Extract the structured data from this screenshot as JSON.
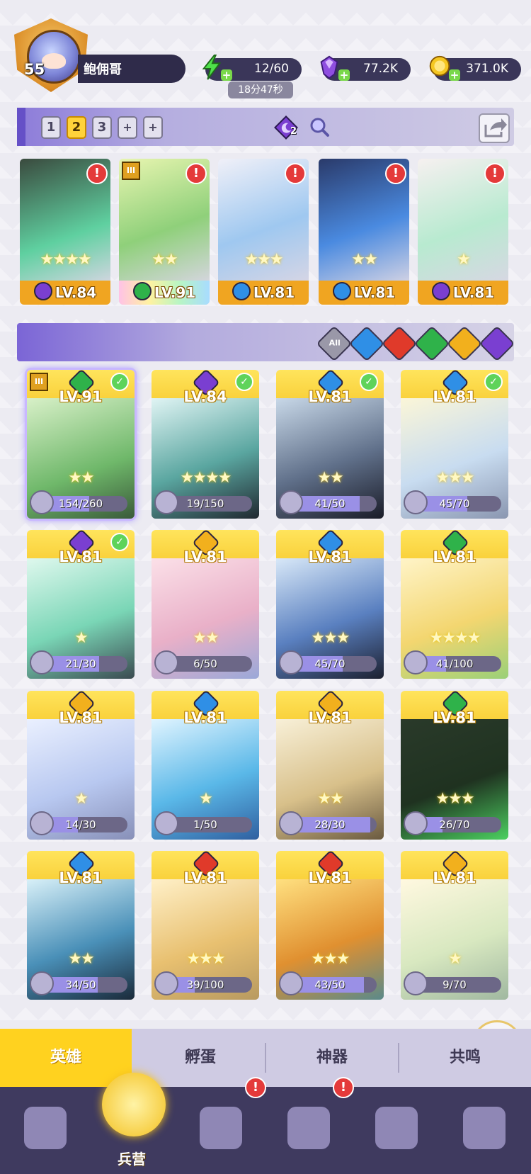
{
  "player": {
    "level": "55",
    "name": "鲍佣哥"
  },
  "resources": {
    "energy": {
      "value": "12/60",
      "timer": "18分47秒",
      "icon": "lightning-icon"
    },
    "gems": {
      "value": "77.2K",
      "icon": "gem-icon"
    },
    "coins": {
      "value": "371.0K",
      "icon": "coin-icon"
    }
  },
  "team_tabs": [
    "1",
    "2",
    "3",
    "+",
    "+"
  ],
  "team_active": "2",
  "team_badge": "2",
  "team": [
    {
      "level": "LV.84",
      "element": "dark",
      "stars": "★★★★",
      "alert": "!"
    },
    {
      "level": "LV.91",
      "element": "nature",
      "stars": "★★",
      "alert": "!",
      "rank": "III"
    },
    {
      "level": "LV.81",
      "element": "water",
      "stars": "★★★",
      "alert": "!"
    },
    {
      "level": "LV.81",
      "element": "water",
      "stars": "★★",
      "alert": "!"
    },
    {
      "level": "LV.81",
      "element": "dark",
      "stars": "★",
      "alert": "!"
    }
  ],
  "filter": {
    "all_label": "All",
    "elements": [
      "water",
      "fire",
      "nature",
      "light",
      "dark"
    ]
  },
  "colors": {
    "water": "#2f8fe6",
    "fire": "#e03a2a",
    "nature": "#2fb24a",
    "light": "#f2b01d",
    "dark": "#7a3fd1",
    "accent_gold": "#ffd21f",
    "panel_purple": "#7b65d6"
  },
  "heroes": [
    {
      "level": "LV.91",
      "element": "nature",
      "progress": "154/260",
      "ratio": 0.59,
      "checked": true,
      "rank": "III",
      "stars": "★★"
    },
    {
      "level": "LV.84",
      "element": "dark",
      "progress": "19/150",
      "ratio": 0.13,
      "checked": true,
      "stars": "★★★★"
    },
    {
      "level": "LV.81",
      "element": "water",
      "progress": "41/50",
      "ratio": 0.82,
      "checked": true,
      "stars": "★★"
    },
    {
      "level": "LV.81",
      "element": "water",
      "progress": "45/70",
      "ratio": 0.64,
      "checked": true,
      "stars": "★★★"
    },
    {
      "level": "LV.81",
      "element": "dark",
      "progress": "21/30",
      "ratio": 0.7,
      "checked": true,
      "stars": "★"
    },
    {
      "level": "LV.81",
      "element": "light",
      "progress": "6/50",
      "ratio": 0.12,
      "checked": false,
      "stars": "★★"
    },
    {
      "level": "LV.81",
      "element": "water",
      "progress": "45/70",
      "ratio": 0.64,
      "checked": false,
      "stars": "★★★"
    },
    {
      "level": "LV.81",
      "element": "nature",
      "progress": "41/100",
      "ratio": 0.41,
      "checked": false,
      "stars": "★★★★"
    },
    {
      "level": "LV.81",
      "element": "light",
      "progress": "14/30",
      "ratio": 0.47,
      "checked": false,
      "stars": "★"
    },
    {
      "level": "LV.81",
      "element": "water",
      "progress": "1/50",
      "ratio": 0.02,
      "checked": false,
      "stars": "★"
    },
    {
      "level": "LV.81",
      "element": "light",
      "progress": "28/30",
      "ratio": 0.93,
      "checked": false,
      "stars": "★★"
    },
    {
      "level": "LV.81",
      "element": "nature",
      "progress": "26/70",
      "ratio": 0.37,
      "checked": false,
      "stars": "★★★"
    },
    {
      "level": "LV.81",
      "element": "water",
      "progress": "34/50",
      "ratio": 0.68,
      "checked": false,
      "stars": "★★"
    },
    {
      "level": "LV.81",
      "element": "fire",
      "progress": "39/100",
      "ratio": 0.39,
      "checked": false,
      "stars": "★★★"
    },
    {
      "level": "LV.81",
      "element": "fire",
      "progress": "43/50",
      "ratio": 0.86,
      "checked": false,
      "stars": "★★★"
    },
    {
      "level": "LV.81",
      "element": "light",
      "progress": "9/70",
      "ratio": 0.13,
      "checked": false,
      "stars": "★"
    }
  ],
  "subtabs": [
    "英雄",
    "孵蛋",
    "神器",
    "共鸣"
  ],
  "subtab_active": "英雄",
  "nav": [
    {
      "icon": "cards-icon",
      "label": ""
    },
    {
      "icon": "barracks-icon",
      "label": "兵营",
      "active": true
    },
    {
      "icon": "map-icon",
      "label": "",
      "alert": "!"
    },
    {
      "icon": "castle-icon",
      "label": "",
      "alert": "!"
    },
    {
      "icon": "mushroom-icon",
      "label": ""
    },
    {
      "icon": "guild-icon",
      "label": ""
    }
  ]
}
